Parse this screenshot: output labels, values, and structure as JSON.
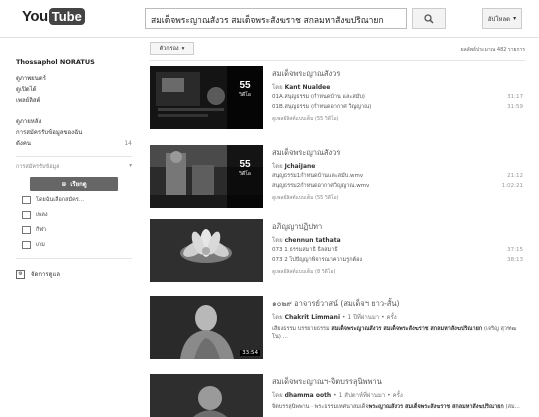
{
  "header": {
    "logo_you": "You",
    "logo_tube": "Tube",
    "search_query": "สมเด็จพระญาณสังวร สมเด็จพระสังฆราช สกลมหาสังฆปริณายก",
    "upload_label": "อัปโหลด"
  },
  "sidebar": {
    "user_name": "Thossaphol NORATUS",
    "links": [
      "ดูภาพยนตร์",
      "ดูเปิดได้",
      "เพลย์ลิสต์"
    ],
    "links2": [
      {
        "label": "ดูภายหลัง",
        "count": ""
      },
      {
        "label": "การสมัครรับข้อมูลของฉัน",
        "count": ""
      },
      {
        "label": "ดังคน",
        "count": "14"
      }
    ],
    "section_label": "การสมัครรับข้อมูล",
    "browse_label": "เรียกดู",
    "subs": [
      "โดยฉันเลือกสมัคร...",
      "เพลง",
      "กีฬา",
      "เกม"
    ],
    "manage_label": "จัดการดูแล"
  },
  "main": {
    "filter_label": "ตัวกรอง",
    "result_count": "ผลลัพธ์ประมาณ 482 รายการ"
  },
  "results": [
    {
      "title": "สมเด็จพระญาณสังวร",
      "by_prefix": "โดย",
      "author": "Kant Nualdee",
      "count": "55",
      "count_label": "วิดีโอ",
      "tracks": [
        {
          "name": "01A.สนุญธรรม (กำหนดบ้าน และสมับ)",
          "dur": "31:17"
        },
        {
          "name": "01B.สนุญธรรม (กำหนดอากาศ วิญญาณ)",
          "dur": "31:59"
        }
      ],
      "view_all": "ดูเพลย์ลิสต์แบบเต็ม (55 วิดีโอ)"
    },
    {
      "title": "สมเด็จพระญาณสังวร",
      "by_prefix": "โดย",
      "author": "JchaiJane",
      "count": "55",
      "count_label": "วิดีโอ",
      "tracks": [
        {
          "name": "สนุญธรรม1กำหนดบ้านและสมับ.wmv",
          "dur": "21:12"
        },
        {
          "name": "สนุญธรรม2กำหนดอากาศวิญญาณ.wmv",
          "dur": "1:02:21"
        }
      ],
      "view_all": "ดูเพลย์ลิสต์แบบเต็ม (55 วิดีโอ)"
    },
    {
      "title": "อภิญญาปฏิปทา",
      "by_prefix": "โดย",
      "author": "chennun tathata",
      "count": "",
      "count_label": "",
      "tracks": [
        {
          "name": "073 1 ธรรมสมาธิ ธิลสมาธิ",
          "dur": "37:15"
        },
        {
          "name": "073 2 ไปปัญญาพิจารณาความรูกต้อง",
          "dur": "38:13"
        }
      ],
      "view_all": "ดูเพลย์ลิสต์แบบเต็ม (8 วิดีโอ)"
    },
    {
      "title": "๑๐๒๙ อาจารย์วาสน์ (สมเด็จฯ ยาว-สั้น)",
      "by_prefix": "โดย",
      "author": "Chakrit Limmani",
      "meta": "1 ปีที่ผ่านมา • ครั้ง",
      "desc_plain": "เสียงธรรม บรรยายธรรม ",
      "desc_bold": "สมเด็จพระญาณสังวร สมเด็จพระสังฆราช สกลมหาสังฆปริณายก",
      "desc_tail": " (เจริญ สุวฑฒโน) ...",
      "duration": "33:54"
    },
    {
      "title": "สมเด็จพระญาณฯ-จิตบรรลุนิพพาน",
      "by_prefix": "โดย",
      "author": "dhamma ooth",
      "meta": "1 สัปดาห์ที่ผ่านมา • ครั้ง",
      "desc_plain": "จิตบรรลุนิพพาน · พระธรรมเทศนาสมเด็จ",
      "desc_bold": "พระญาณสังวร สมเด็จพระสังฆราช สกลมหาสังฆปริณายก",
      "desc_tail": " (สม..."
    }
  ]
}
